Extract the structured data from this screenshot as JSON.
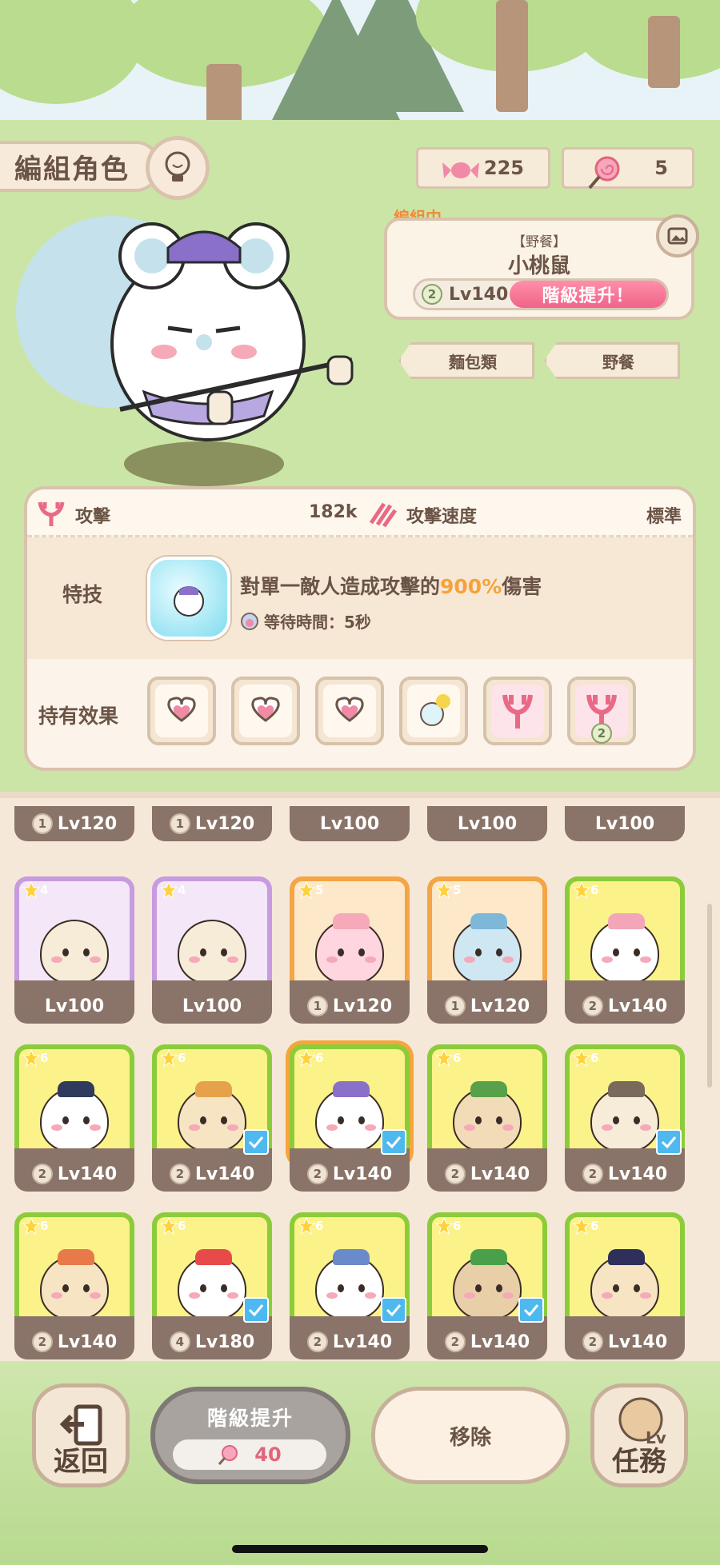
{
  "header": {
    "title": "編組角色"
  },
  "currency": {
    "candy": "225",
    "lollipop": "5"
  },
  "team": {
    "status_label": "編組中",
    "tag": "【野餐】",
    "name": "小桃鼠",
    "rank": "2",
    "level": "Lv140",
    "upgrade_label": "階級提升！",
    "categories": [
      "麵包類",
      "野餐"
    ]
  },
  "stats": {
    "attack_label": "攻擊",
    "attack_value": "182k",
    "speed_label": "攻擊速度",
    "speed_value": "標準",
    "skill_label": "特技",
    "skill_desc_prefix": "對單一敵人造成攻擊的",
    "skill_desc_highlight": "900%",
    "skill_desc_suffix": "傷害",
    "skill_wait": "等待時間：5秒",
    "effects_label": "持有效果",
    "effects": [
      {
        "icon": "heart-icon"
      },
      {
        "icon": "heart-icon"
      },
      {
        "icon": "heart-icon"
      },
      {
        "icon": "potion-icon"
      },
      {
        "icon": "attack-fork-icon"
      },
      {
        "icon": "attack-fork-icon",
        "rank": "2"
      }
    ]
  },
  "grid": {
    "partial_row": [
      {
        "rank": "1",
        "level": "Lv120"
      },
      {
        "rank": "1",
        "level": "Lv120"
      },
      {
        "rank": "",
        "level": "Lv100"
      },
      {
        "rank": "",
        "level": "Lv100"
      },
      {
        "rank": "",
        "level": "Lv100"
      }
    ],
    "rows": [
      [
        {
          "stars": "4",
          "rank": "",
          "level": "Lv100",
          "checked": false
        },
        {
          "stars": "4",
          "rank": "",
          "level": "Lv100",
          "checked": false
        },
        {
          "stars": "5",
          "rank": "1",
          "level": "Lv120",
          "checked": false
        },
        {
          "stars": "5",
          "rank": "1",
          "level": "Lv120",
          "checked": false
        },
        {
          "stars": "6",
          "rank": "2",
          "level": "Lv140",
          "checked": false
        }
      ],
      [
        {
          "stars": "6",
          "rank": "2",
          "level": "Lv140",
          "checked": false
        },
        {
          "stars": "6",
          "rank": "2",
          "level": "Lv140",
          "checked": true
        },
        {
          "stars": "6",
          "rank": "2",
          "level": "Lv140",
          "checked": true
        },
        {
          "stars": "6",
          "rank": "2",
          "level": "Lv140",
          "checked": false
        },
        {
          "stars": "6",
          "rank": "2",
          "level": "Lv140",
          "checked": true
        }
      ],
      [
        {
          "stars": "6",
          "rank": "2",
          "level": "Lv140",
          "checked": false
        },
        {
          "stars": "6",
          "rank": "4",
          "level": "Lv180",
          "checked": true
        },
        {
          "stars": "6",
          "rank": "2",
          "level": "Lv140",
          "checked": true
        },
        {
          "stars": "6",
          "rank": "2",
          "level": "Lv140",
          "checked": true
        },
        {
          "stars": "6",
          "rank": "2",
          "level": "Lv140",
          "checked": false
        }
      ]
    ]
  },
  "bottom": {
    "back_label": "返回",
    "upgrade_label": "階級提升",
    "upgrade_cost": "40",
    "remove_label": "移除",
    "mission_label": "任務",
    "mission_badge": "Lv"
  },
  "colors": {
    "accent_pink": "#f0648a",
    "highlight_orange": "#f6a23a",
    "check_blue": "#4eb9ef",
    "selected_border": "#f6a53b"
  }
}
